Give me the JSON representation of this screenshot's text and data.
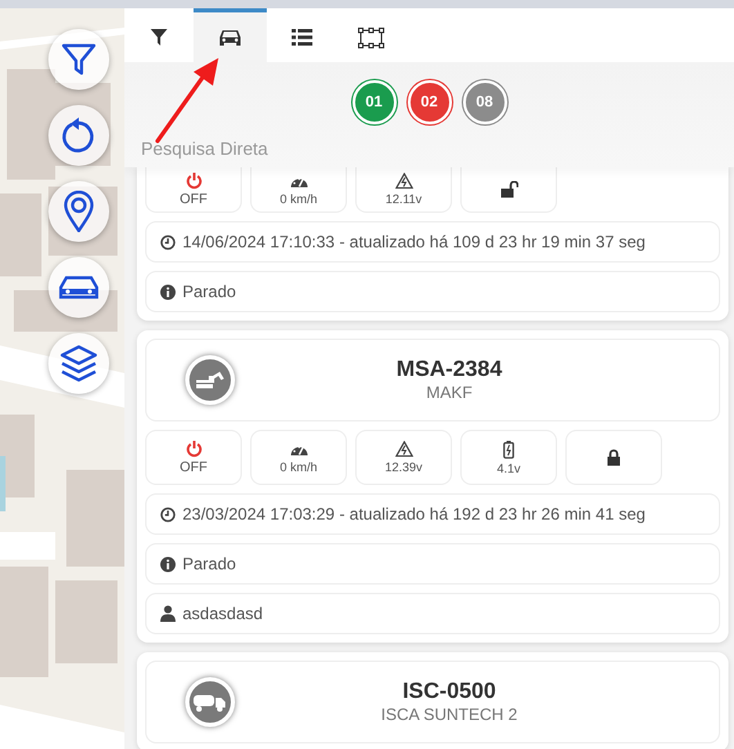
{
  "map_controls": [
    {
      "kind": "filter"
    },
    {
      "kind": "refresh"
    },
    {
      "kind": "pin"
    },
    {
      "kind": "car"
    },
    {
      "kind": "layers"
    }
  ],
  "tabs": [
    {
      "kind": "filter",
      "selected": false
    },
    {
      "kind": "car",
      "selected": true
    },
    {
      "kind": "list",
      "selected": false
    },
    {
      "kind": "area",
      "selected": false
    }
  ],
  "status_counts": [
    {
      "label": "01",
      "color": "#1a9c4e"
    },
    {
      "label": "02",
      "color": "#e53935"
    },
    {
      "label": "08",
      "color": "#8c8c8c"
    }
  ],
  "search_label": "Pesquisa Direta",
  "vehicles": [
    {
      "stats": [
        {
          "kind": "ignition",
          "on": false,
          "text": "OFF"
        },
        {
          "kind": "speed",
          "text": "0 km/h"
        },
        {
          "kind": "voltage",
          "text": "12.11v"
        },
        {
          "kind": "lock",
          "locked": false
        }
      ],
      "info": [
        {
          "kind": "clock",
          "text": "14/06/2024 17:10:33 - atualizado há 109 d 23 hr 19 min 37 seg"
        },
        {
          "kind": "status",
          "text": "Parado"
        }
      ]
    },
    {
      "kind": "excavator",
      "plate": "MSA-2384",
      "model": "MAKF",
      "stats": [
        {
          "kind": "ignition",
          "on": false,
          "text": "OFF"
        },
        {
          "kind": "speed",
          "text": "0 km/h"
        },
        {
          "kind": "voltage",
          "text": "12.39v"
        },
        {
          "kind": "battery",
          "text": "4.1v"
        },
        {
          "kind": "lock",
          "locked": true
        }
      ],
      "info": [
        {
          "kind": "clock",
          "text": "23/03/2024 17:03:29 - atualizado há 192 d 23 hr 26 min 41 seg"
        },
        {
          "kind": "status",
          "text": "Parado"
        },
        {
          "kind": "driver",
          "text": "asdasdasd"
        }
      ]
    },
    {
      "kind": "truck",
      "plate": "ISC-0500",
      "model": "ISCA SUNTECH 2"
    }
  ]
}
